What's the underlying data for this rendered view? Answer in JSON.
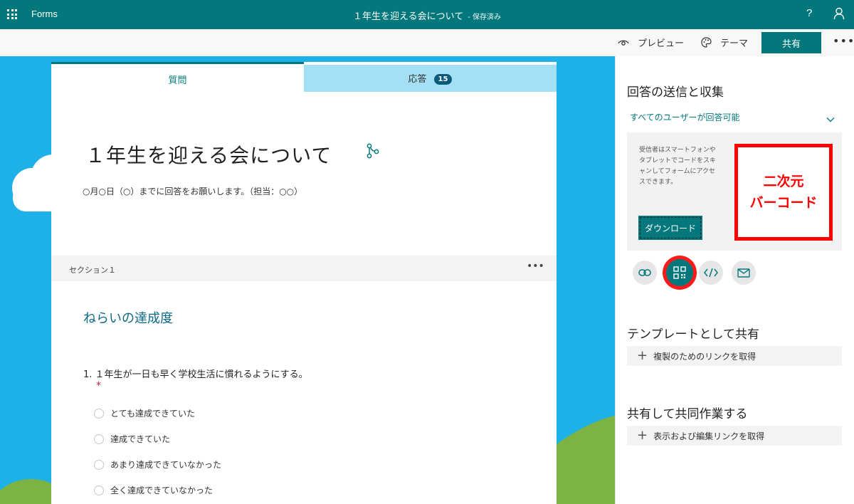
{
  "app": {
    "name": "Forms",
    "doc_title": "１年生を迎える会について",
    "save_status": "- 保存済み",
    "help": "?"
  },
  "commands": {
    "preview": "プレビュー",
    "theme": "テーマ",
    "share": "共有",
    "more": "•••"
  },
  "tabs": {
    "questions": "質問",
    "responses": "応答",
    "responses_count": "15"
  },
  "form": {
    "title": "１年生を迎える会について",
    "description": "○月○日（○）までに回答をお願いします。（担当：○○）",
    "section_label": "セクション１",
    "section_more": "•••",
    "heading": "ねらいの達成度",
    "question": {
      "number": "1.",
      "text": "１年生が一日も早く学校生活に慣れるようにする。",
      "required_mark": "*",
      "options": [
        "とても達成できていた",
        "達成できていた",
        "あまり達成できていなかった",
        "全く達成できていなかった"
      ]
    }
  },
  "share_pane": {
    "title": "回答の送信と収集",
    "audience": "すべてのユーザーが回答可能",
    "qr_info": "受信者はスマートフォンやタブレットでコードをスキャンしてフォームにアクセスできます。",
    "download": "ダウンロード",
    "qr_annotation_line1": "二次元",
    "qr_annotation_line2": "バーコード",
    "share_icons": [
      "link-icon",
      "qr-code-icon",
      "embed-icon",
      "email-icon"
    ],
    "template_title": "テンプレートとして共有",
    "template_link": "複製のためのリンクを取得",
    "collab_title": "共有して共同作業する",
    "collab_link": "表示および編集リンクを取得"
  },
  "colors": {
    "accent": "#03787c",
    "background": "#1eb1e8",
    "annotation": "#ff0000"
  }
}
